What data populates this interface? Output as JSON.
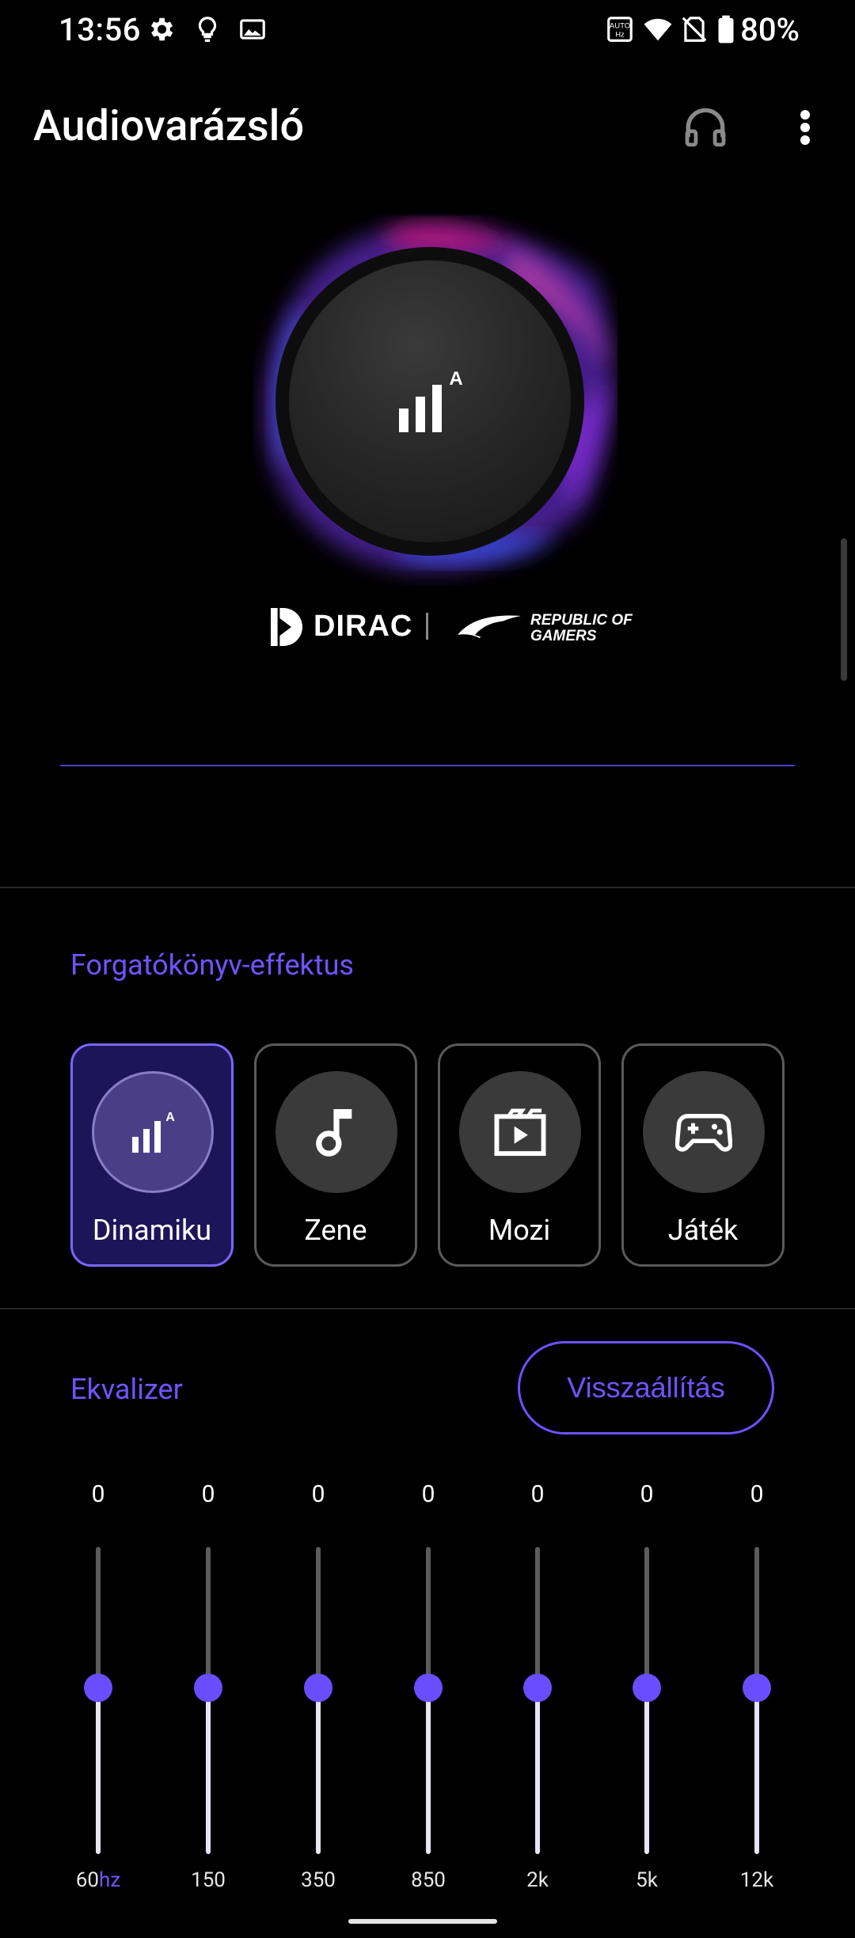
{
  "status_bar": {
    "time": "13:56",
    "battery": "80%",
    "left_icons": [
      "gear-icon",
      "lightbulb-icon",
      "image-icon"
    ],
    "right_icons": [
      "auto-hz-icon",
      "wifi-icon",
      "no-sim-icon",
      "battery-icon"
    ]
  },
  "app_bar": {
    "title": "Audiovarázsló",
    "actions": [
      "headphones-icon",
      "more-vert-icon"
    ]
  },
  "hero": {
    "icon": "equalizer-auto-icon",
    "badge": "A",
    "brand_dirac": "DIRAC",
    "brand_rog_line1": "REPUBLIC OF",
    "brand_rog_line2": "GAMERS"
  },
  "scenario": {
    "title": "Forgatókönyv-effektus",
    "selected_index": 0,
    "items": [
      {
        "label": "Dinamiku",
        "icon": "equalizer-auto-icon",
        "badge": "A"
      },
      {
        "label": "Zene",
        "icon": "music-note-icon"
      },
      {
        "label": "Mozi",
        "icon": "movie-icon"
      },
      {
        "label": "Játék",
        "icon": "gamepad-icon"
      }
    ]
  },
  "equalizer": {
    "title": "Ekvalizer",
    "reset_label": "Visszaállítás",
    "unit": "hz",
    "bands": [
      {
        "label": "60",
        "value": "0"
      },
      {
        "label": "150",
        "value": "0"
      },
      {
        "label": "350",
        "value": "0"
      },
      {
        "label": "850",
        "value": "0"
      },
      {
        "label": "2k",
        "value": "0"
      },
      {
        "label": "5k",
        "value": "0"
      },
      {
        "label": "12k",
        "value": "0"
      }
    ]
  },
  "colors": {
    "accent": "#6e55ff",
    "active_card_bg": "#1e1458",
    "background": "#000000"
  }
}
